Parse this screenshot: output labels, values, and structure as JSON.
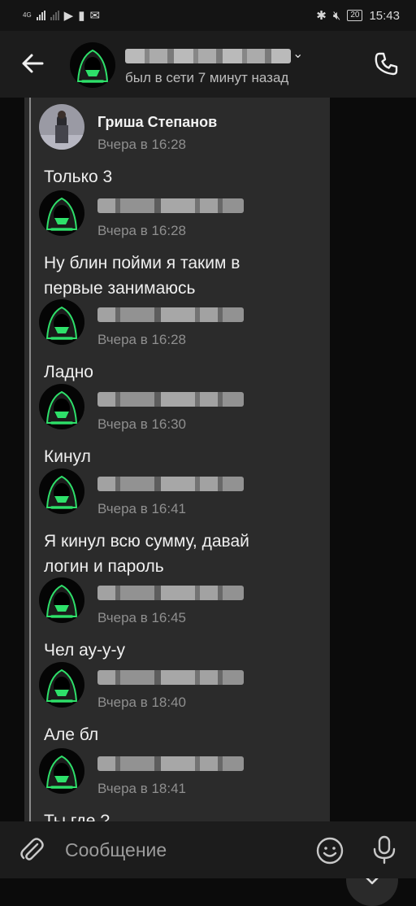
{
  "status_bar": {
    "net_label": "4G",
    "battery": "20",
    "time": "15:43"
  },
  "header": {
    "contact_status": "был в сети 7 минут назад",
    "chevron": "⌄"
  },
  "messages": [
    {
      "author": "Гриша Степанов",
      "time": "Вчера в 16:28",
      "text": "Только 3"
    },
    {
      "time": "Вчера в 16:28",
      "text": "Ну блин пойми я таким в\nпервые занимаюсь"
    },
    {
      "time": "Вчера в 16:28",
      "text": "Ладно"
    },
    {
      "time": "Вчера в 16:30",
      "text": "Кинул"
    },
    {
      "time": "Вчера в 16:41",
      "text": "Я кинул всю сумму, давай\nлогин и пароль"
    },
    {
      "time": "Вчера в 16:45",
      "text": "Чел ау-у-у"
    },
    {
      "time": "Вчера в 18:40",
      "text": "Але бл"
    },
    {
      "time": "Вчера в 18:41",
      "text": "Ты где ?"
    }
  ],
  "composer": {
    "placeholder": "Сообщение"
  },
  "icons": {
    "back": "arrow-left-icon",
    "call": "phone-icon",
    "scroll_down": "chevron-down-icon",
    "attach": "paperclip-icon",
    "emoji": "smile-icon",
    "mic": "microphone-icon"
  },
  "colors": {
    "background": "#0b0b0b",
    "bubble": "#2b2b2b",
    "header": "#1c1c1c",
    "accent_green": "#2ee06a"
  }
}
